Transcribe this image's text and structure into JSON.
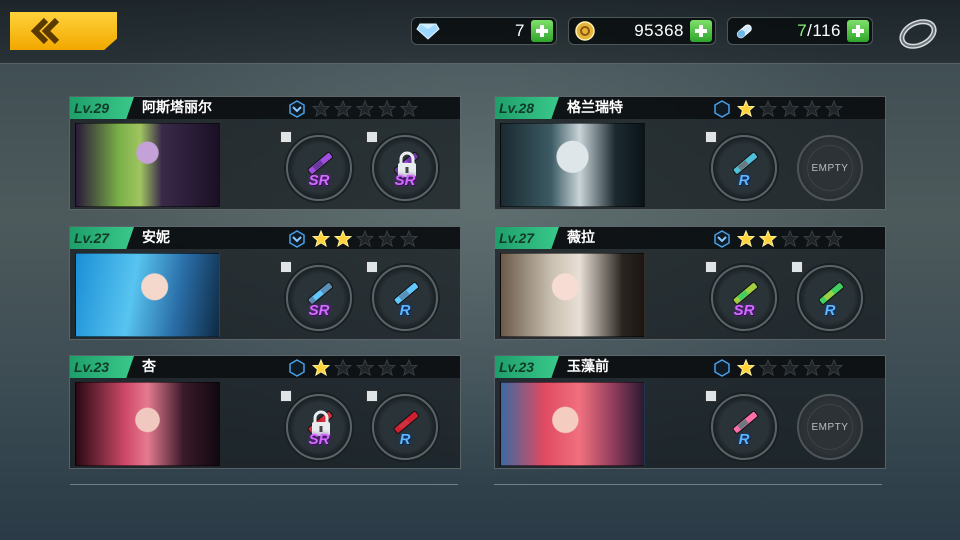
{
  "resources": {
    "crystals": "7",
    "gold": "95368",
    "stamina_current": "7",
    "stamina_max": "/116"
  },
  "characters": [
    {
      "level": "Lv.29",
      "name": "阿斯塔丽尔",
      "stars": 0,
      "slot1": "SR",
      "slot2": "SR",
      "slot2_locked": true,
      "slot2_empty": false
    },
    {
      "level": "Lv.28",
      "name": "格兰瑞特",
      "stars": 1,
      "slot1": "R",
      "slot2": "",
      "slot2_locked": false,
      "slot2_empty": true,
      "empty_label": "EMPTY"
    },
    {
      "level": "Lv.27",
      "name": "安妮",
      "stars": 2,
      "slot1": "SR",
      "slot2": "R",
      "slot2_locked": false,
      "slot2_empty": false
    },
    {
      "level": "Lv.27",
      "name": "薇拉",
      "stars": 2,
      "slot1": "SR",
      "slot2": "R",
      "slot2_locked": false,
      "slot2_empty": false
    },
    {
      "level": "Lv.23",
      "name": "杏",
      "stars": 1,
      "slot1": "SR",
      "slot1_locked": true,
      "slot2": "R",
      "slot2_locked": false,
      "slot2_empty": false
    },
    {
      "level": "Lv.23",
      "name": "玉藻前",
      "stars": 1,
      "slot1": "R",
      "slot2": "",
      "slot2_locked": false,
      "slot2_empty": true,
      "empty_label": "EMPTY"
    }
  ],
  "colors": {
    "accent_yellow": "#ffd23a",
    "level_green": "#39c98a",
    "sr_purple": "#d46bff",
    "r_blue": "#5fb6ff",
    "star_gold": "#ffd23a"
  }
}
